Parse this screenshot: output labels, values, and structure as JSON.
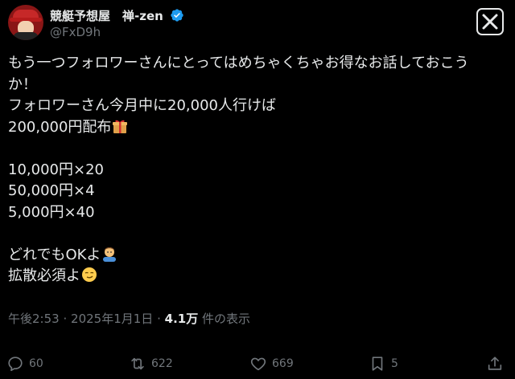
{
  "author": {
    "display_name": "競艇予想屋　禅-zen",
    "handle": "@FxD9h"
  },
  "tweet": {
    "lines": [
      "もう一つフォロワーさんにとってはめちゃくちゃお得なお話しておこう",
      "か！",
      "フォロワーさん今月中に20,000人行けば",
      "200,000円配布",
      "",
      "10,000円×20",
      "50,000円×4",
      "5,000円×40",
      "",
      "どれでもOKよ",
      "拡散必須よ"
    ]
  },
  "meta": {
    "time": "午後2:53",
    "separator1": "·",
    "date": "2025年1月1日",
    "separator2": "·",
    "views_count": "4.1万",
    "views_label": "件の表示"
  },
  "actions": {
    "replies": "60",
    "reposts": "622",
    "likes": "669",
    "bookmarks": "5"
  },
  "icons": {
    "x_logo": "x-logo-icon",
    "verified": "verified-badge-icon",
    "gift": "gift-emoji-icon",
    "person": "person-emoji-icon",
    "smirk": "smirk-emoji-icon",
    "reply": "reply-icon",
    "repost": "repost-icon",
    "like": "heart-icon",
    "bookmark": "bookmark-icon",
    "share": "share-icon"
  },
  "colors": {
    "background": "#000000",
    "text": "#e7e9ea",
    "muted": "#71767b",
    "verified": "#1d9bf0"
  }
}
